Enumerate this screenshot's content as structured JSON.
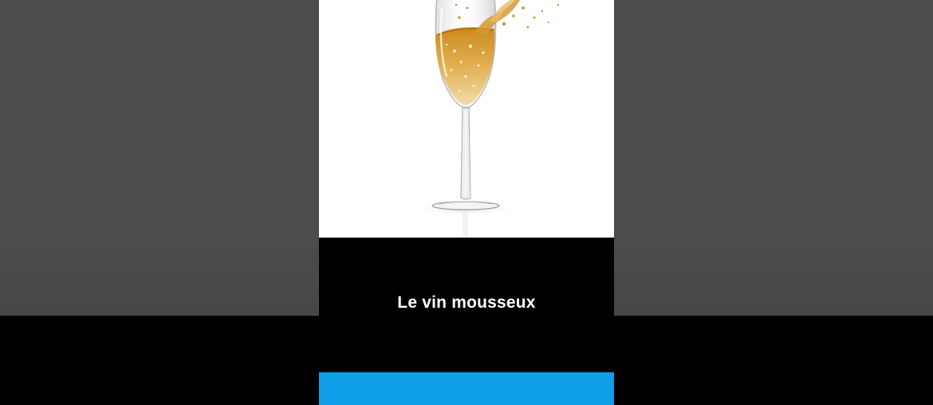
{
  "card": {
    "image_subject": "champagne-glass",
    "caption": "Le vin mousseux"
  },
  "colors": {
    "background_gray": "#4c4c4c",
    "card_black": "#000000",
    "photo_white": "#ffffff",
    "accent_blue": "#0e9fe8",
    "wine_gold": "#d9a441"
  }
}
